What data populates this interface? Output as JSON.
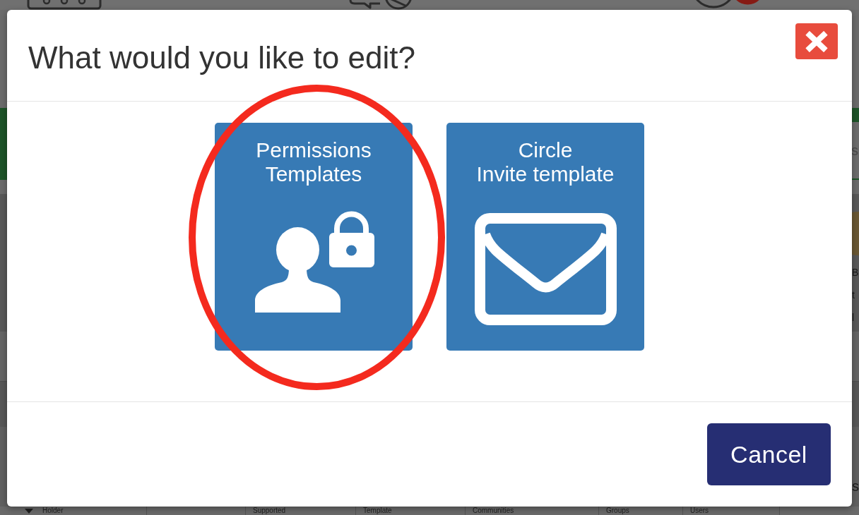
{
  "background": {
    "field_fragment": "s",
    "side_labels": [
      "B",
      "t",
      "l"
    ],
    "corner_fragment": "s",
    "table_columns": [
      {
        "label": "Holder",
        "sorted": true
      },
      {
        "label": "Supported",
        "sorted": false
      },
      {
        "label": "Template",
        "sorted": false
      },
      {
        "label": "Communities",
        "sorted": false
      },
      {
        "label": "Groups",
        "sorted": false
      },
      {
        "label": "Users",
        "sorted": false
      }
    ]
  },
  "dialog": {
    "title": "What would you like to edit?",
    "options": [
      {
        "kind": "permissions",
        "lines": [
          "Permissions",
          "Templates"
        ],
        "highlighted": true
      },
      {
        "kind": "invite",
        "lines": [
          "Circle",
          "Invite template"
        ],
        "highlighted": false
      }
    ],
    "buttons": [
      {
        "label": "Cancel"
      }
    ]
  }
}
